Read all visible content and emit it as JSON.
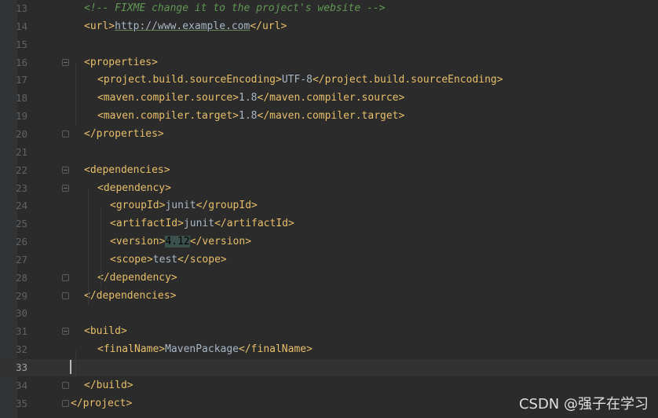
{
  "editor": {
    "lines": [
      {
        "num": "13",
        "parts": [
          [
            "c",
            "<!-- FIXME change it to the project's website -->"
          ]
        ]
      },
      {
        "num": "14",
        "parts": [
          [
            "t",
            "<url>"
          ],
          [
            "u",
            "http://www.example.com"
          ],
          [
            "t",
            "</url>"
          ]
        ]
      },
      {
        "num": "15",
        "parts": []
      },
      {
        "num": "16",
        "parts": [
          [
            "t",
            "<properties>"
          ]
        ]
      },
      {
        "num": "17",
        "parts": [
          [
            "t",
            "<project.build.sourceEncoding>"
          ],
          [
            "x",
            "UTF-8"
          ],
          [
            "t",
            "</project.build.sourceEncoding>"
          ]
        ]
      },
      {
        "num": "18",
        "parts": [
          [
            "t",
            "<maven.compiler.source>"
          ],
          [
            "x",
            "1.8"
          ],
          [
            "t",
            "</maven.compiler.source>"
          ]
        ]
      },
      {
        "num": "19",
        "parts": [
          [
            "t",
            "<maven.compiler.target>"
          ],
          [
            "x",
            "1.8"
          ],
          [
            "t",
            "</maven.compiler.target>"
          ]
        ]
      },
      {
        "num": "20",
        "parts": [
          [
            "t",
            "</properties>"
          ]
        ]
      },
      {
        "num": "21",
        "parts": []
      },
      {
        "num": "22",
        "parts": [
          [
            "t",
            "<dependencies>"
          ]
        ]
      },
      {
        "num": "23",
        "parts": [
          [
            "t",
            "<dependency>"
          ]
        ]
      },
      {
        "num": "24",
        "parts": [
          [
            "t",
            "<groupId>"
          ],
          [
            "x",
            "junit"
          ],
          [
            "t",
            "</groupId>"
          ]
        ]
      },
      {
        "num": "25",
        "parts": [
          [
            "t",
            "<artifactId>"
          ],
          [
            "x",
            "junit"
          ],
          [
            "t",
            "</artifactId>"
          ]
        ]
      },
      {
        "num": "26",
        "parts": [
          [
            "t",
            "<version>"
          ],
          [
            "hl",
            "4.12"
          ],
          [
            "t",
            "</version>"
          ]
        ]
      },
      {
        "num": "27",
        "parts": [
          [
            "t",
            "<scope>"
          ],
          [
            "x",
            "test"
          ],
          [
            "t",
            "</scope>"
          ]
        ]
      },
      {
        "num": "28",
        "parts": [
          [
            "t",
            "</dependency>"
          ]
        ]
      },
      {
        "num": "29",
        "parts": [
          [
            "t",
            "</dependencies>"
          ]
        ]
      },
      {
        "num": "30",
        "parts": []
      },
      {
        "num": "31",
        "parts": [
          [
            "t",
            "<build>"
          ]
        ]
      },
      {
        "num": "32",
        "parts": [
          [
            "t",
            "<finalName>"
          ],
          [
            "x",
            "MavenPackage"
          ],
          [
            "t",
            "</finalName>"
          ]
        ]
      },
      {
        "num": "33",
        "parts": []
      },
      {
        "num": "34",
        "parts": [
          [
            "t",
            "</build>"
          ]
        ]
      },
      {
        "num": "35",
        "parts": [
          [
            "t",
            "</project>"
          ]
        ]
      }
    ],
    "current_line": "33"
  },
  "watermark": "CSDN @强子在学习"
}
